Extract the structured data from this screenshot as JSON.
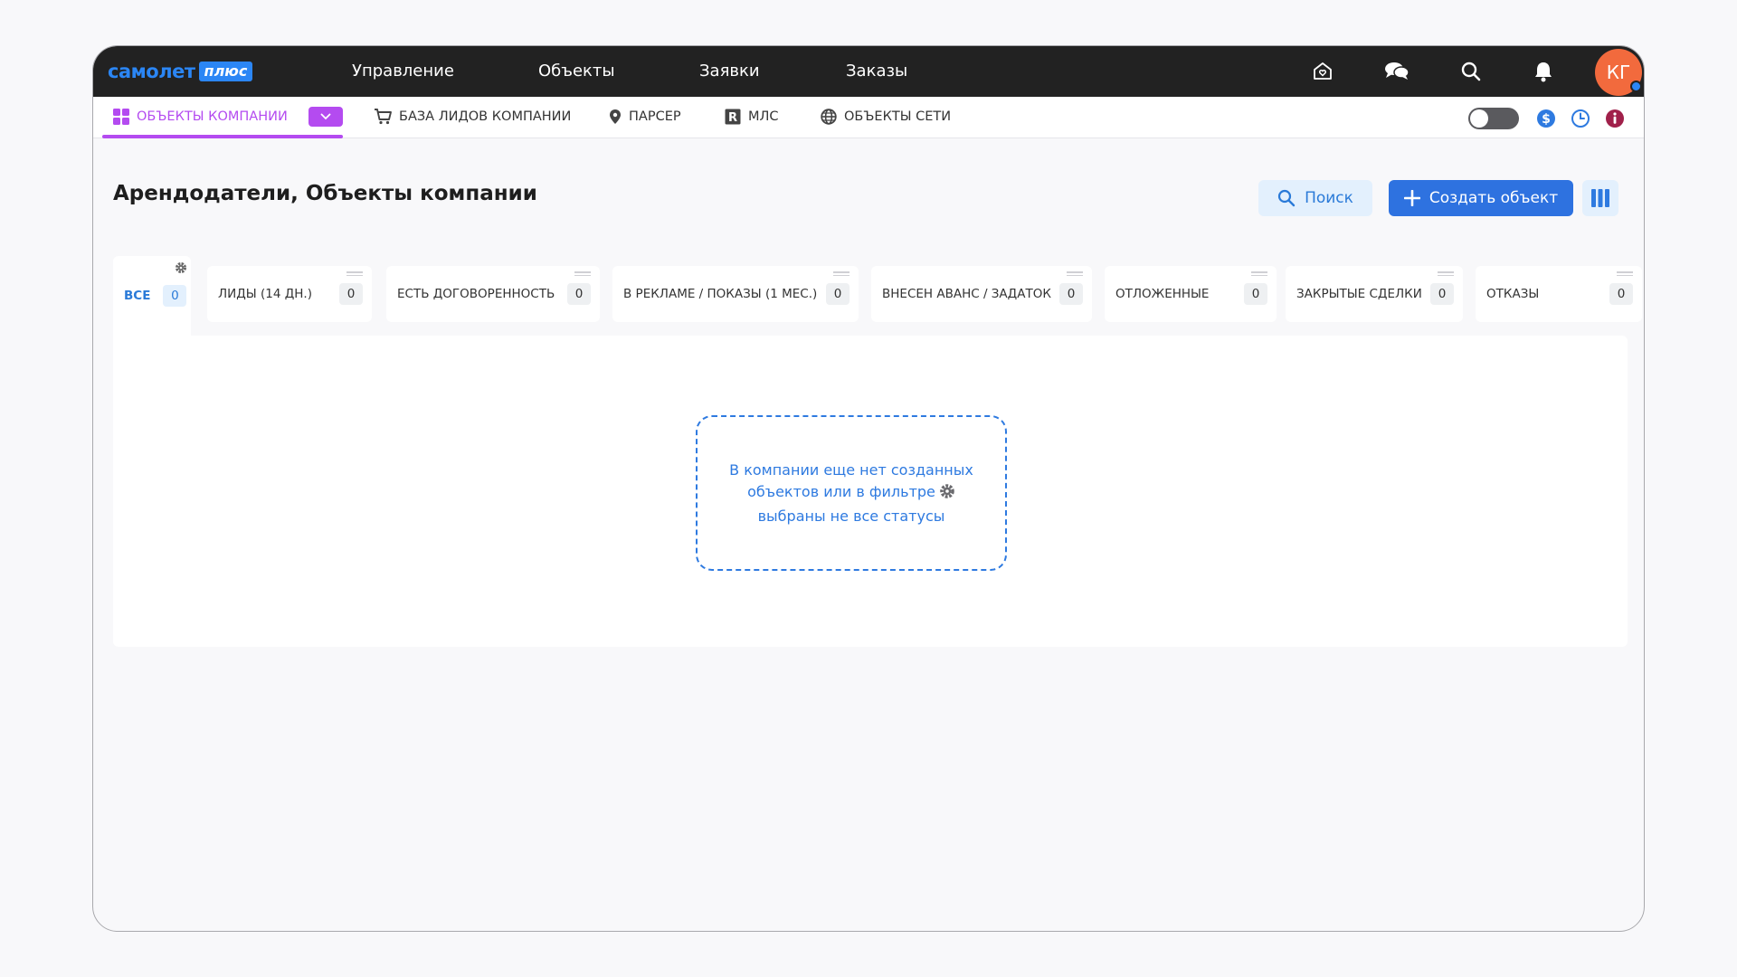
{
  "brand": {
    "name": "самолет",
    "plus": "плюс",
    "color": "#2b86f5"
  },
  "topnav": {
    "items": [
      {
        "label": "Управление"
      },
      {
        "label": "Объекты"
      },
      {
        "label": "Заявки"
      },
      {
        "label": "Заказы"
      }
    ],
    "icons": [
      "home-heart-icon",
      "chat-icon",
      "search-icon",
      "bell-icon"
    ],
    "avatar": {
      "initials": "КГ",
      "color": "#f26a3d"
    }
  },
  "subnav": {
    "items": [
      {
        "label": "ОБЪЕКТЫ КОМПАНИИ",
        "icon": "grid-icon",
        "active": true
      },
      {
        "label": "БАЗА ЛИДОВ КОМПАНИИ",
        "icon": "cart-icon"
      },
      {
        "label": "ПАРСЕР",
        "icon": "pin-icon"
      },
      {
        "label": "МЛС",
        "icon": "r-badge-icon"
      },
      {
        "label": "ОБЪЕКТЫ СЕТИ",
        "icon": "globe-icon"
      }
    ],
    "accent": "#b44bf0",
    "toggle_on": false,
    "right_icons": [
      "dollar-icon",
      "clock-icon",
      "info-icon"
    ]
  },
  "page": {
    "title": "Арендодатели, Объекты компании",
    "search_label": "Поиск",
    "create_label": "Создать объект"
  },
  "tabs": [
    {
      "label": "ВСЕ",
      "count": "0"
    },
    {
      "label": "ЛИДЫ (14 ДН.)",
      "count": "0"
    },
    {
      "label": "ЕСТЬ ДОГОВОРЕННОСТЬ",
      "count": "0"
    },
    {
      "label": "В РЕКЛАМЕ / ПОКАЗЫ (1 МЕС.)",
      "count": "0"
    },
    {
      "label": "ВНЕСЕН АВАНС / ЗАДАТОК",
      "count": "0"
    },
    {
      "label": "ОТЛОЖЕННЫЕ",
      "count": "0"
    },
    {
      "label": "ЗАКРЫТЫЕ СДЕЛКИ",
      "count": "0"
    },
    {
      "label": "ОТКАЗЫ",
      "count": "0"
    }
  ],
  "empty_state": {
    "line1": "В компании еще нет созданных",
    "line2": "объектов или в фильтре",
    "line3": "выбраны не все статусы"
  }
}
